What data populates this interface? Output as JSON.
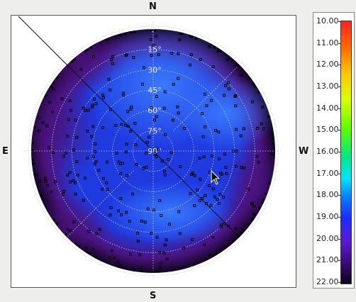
{
  "compass": {
    "north": "N",
    "south": "S",
    "east": "E",
    "west": "W"
  },
  "chart_data": {
    "type": "heatmap",
    "projection": "polar (azimuth/altitude sky map)",
    "altitude_rings": [
      "0°",
      "15°",
      "30°",
      "45°",
      "60°",
      "75°",
      "90°"
    ],
    "colorbar": {
      "ticks": [
        "10.00",
        "11.00",
        "12.00",
        "13.00",
        "14.00",
        "15.00",
        "16.00",
        "17.00",
        "18.00",
        "19.00",
        "20.00",
        "21.00",
        "22.00"
      ],
      "range": [
        10.0,
        22.0
      ],
      "direction": "top-to-bottom",
      "colors": [
        "#ff2222",
        "#ff6a00",
        "#ffc800",
        "#5cff00",
        "#00e5ff",
        "#1a2cff",
        "#5a1ad0",
        "#0d0418"
      ]
    },
    "field_colors": {
      "bright": "#3b7cff",
      "mid": "#1f3be0",
      "dark": "#4a1380",
      "edge": "#12051f"
    }
  }
}
